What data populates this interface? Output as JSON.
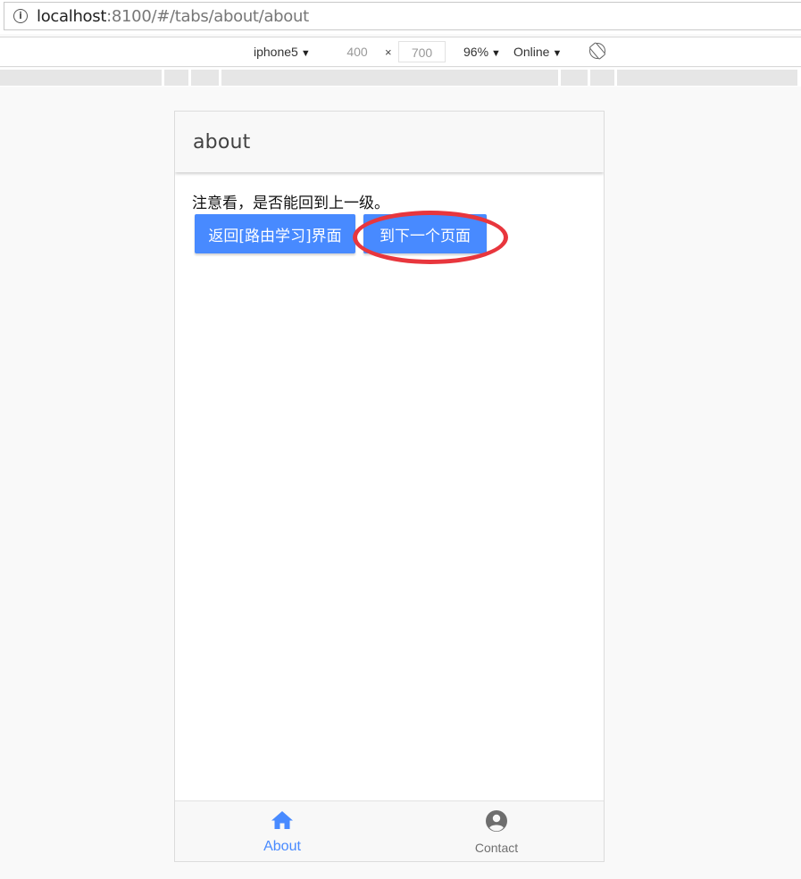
{
  "browser": {
    "url_host": "localhost",
    "url_rest": ":8100/#/tabs/about/about"
  },
  "device_toolbar": {
    "device": "iphone5",
    "width": "400",
    "times": "×",
    "height": "700",
    "zoom": "96%",
    "network": "Online"
  },
  "page": {
    "title": "about",
    "hint": "注意看，是否能回到上一级。",
    "back_button": "返回[路由学习]界面",
    "next_button": "到下一个页面"
  },
  "tabs": [
    {
      "label": "About",
      "icon": "home-icon",
      "active": true
    },
    {
      "label": "Contact",
      "icon": "person-circle-icon",
      "active": false
    }
  ],
  "colors": {
    "primary": "#488aff",
    "annotation": "#e8363d"
  }
}
